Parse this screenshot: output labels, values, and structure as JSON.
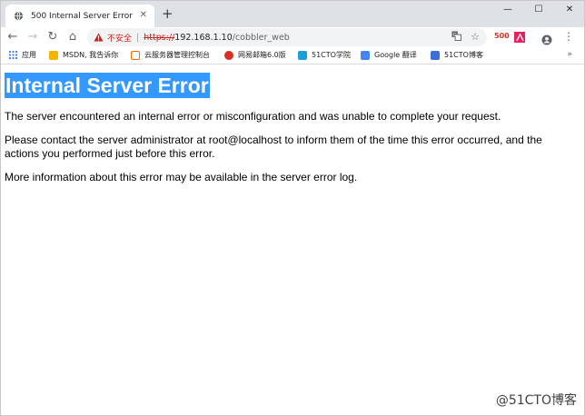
{
  "tab": {
    "title": "500 Internal Server Error",
    "close_glyph": "✕",
    "new_tab_glyph": "+"
  },
  "window_controls": {
    "minimize": "—",
    "maximize": "☐",
    "close": "✕"
  },
  "toolbar": {
    "back_glyph": "←",
    "forward_glyph": "→",
    "reload_glyph": "↻",
    "home_glyph": "⌂",
    "menu_glyph": "⋮"
  },
  "omnibox": {
    "security_label": "不安全",
    "separator": "|",
    "url_scheme": "https://",
    "url_host": "192.168.1.10",
    "url_path": "/cobbler_web",
    "star_glyph": "☆"
  },
  "extensions": {
    "status_code": "500"
  },
  "bookmarks": [
    {
      "label": "应用",
      "icon": "apps-grid-icon",
      "color": "#4285f4"
    },
    {
      "label": "MSDN, 我告诉你",
      "icon": "msdn-icon",
      "color": "#f4b400"
    },
    {
      "label": "云服务器管理控制台",
      "icon": "cloud-console-icon",
      "color": "#ff6a00"
    },
    {
      "label": "网易邮箱6.0版",
      "icon": "netease-mail-icon",
      "color": "#d93025"
    },
    {
      "label": "51CTO学院",
      "icon": "51cto-school-icon",
      "color": "#1a9fd8"
    },
    {
      "label": "Google 翻译",
      "icon": "google-translate-icon",
      "color": "#4285f4"
    },
    {
      "label": "51CTO博客",
      "icon": "51cto-blog-icon",
      "color": "#3b6fd8"
    }
  ],
  "bookmarks_more": "»",
  "page": {
    "heading": "Internal Server Error",
    "p1": "The server encountered an internal error or misconfiguration and was unable to complete your request.",
    "p2": "Please contact the server administrator at root@localhost to inform them of the time this error occurred, and the actions you performed just before this error.",
    "p3": "More information about this error may be available in the server error log."
  },
  "watermark": "@51CTO博客",
  "colors": {
    "selection_highlight": "#3399ff",
    "insecure_red": "#c5221f",
    "titlebar_bg": "#dee1e6"
  }
}
